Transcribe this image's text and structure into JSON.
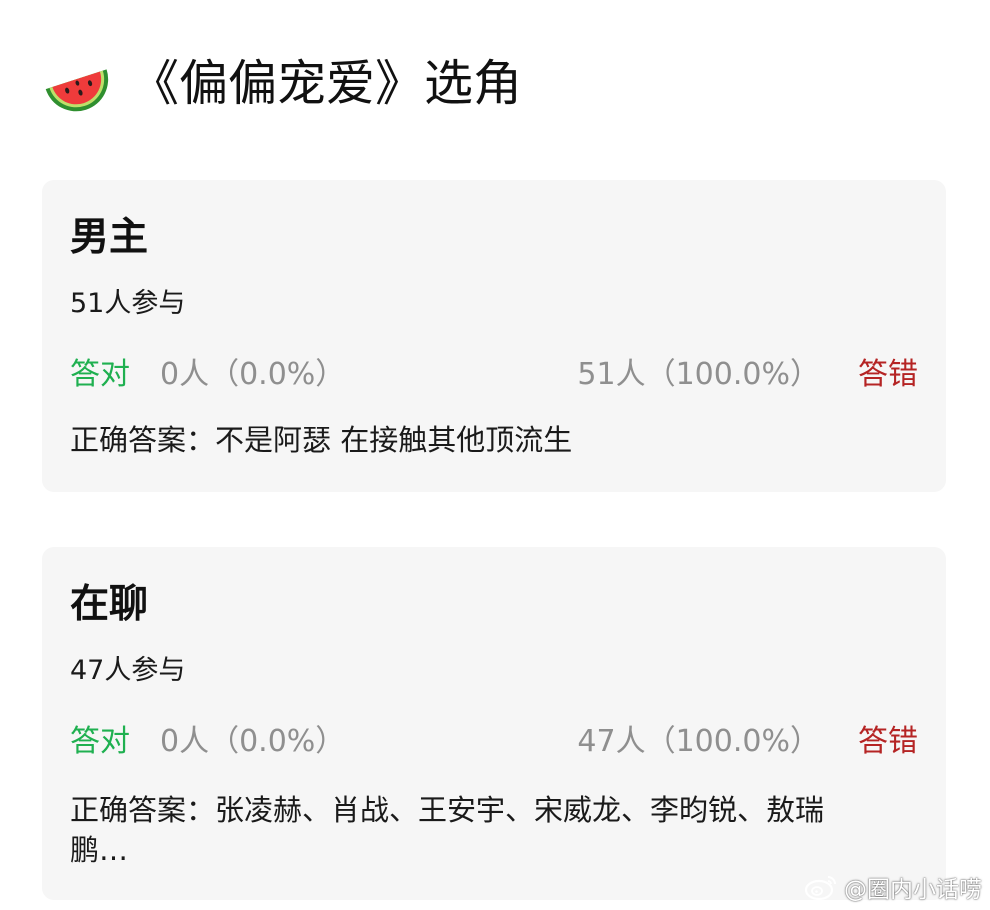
{
  "header": {
    "icon": "watermelon-icon",
    "title": "《偏偏宠爱》选角"
  },
  "cards": [
    {
      "title": "男主",
      "participants": "51人参与",
      "correct_label": "答对",
      "correct_stat": "0人（0.0%）",
      "wrong_stat": "51人（100.0%）",
      "wrong_label": "答错",
      "answer": "正确答案：不是阿瑟 在接触其他顶流生"
    },
    {
      "title": "在聊",
      "participants": "47人参与",
      "correct_label": "答对",
      "correct_stat": "0人（0.0%）",
      "wrong_stat": "47人（100.0%）",
      "wrong_label": "答错",
      "answer": "正确答案：张凌赫、肖战、王安宇、宋威龙、李昀锐、敖瑞鹏…"
    }
  ],
  "watermark": {
    "icon": "weibo-icon",
    "text": "@圈内小话唠"
  },
  "colors": {
    "correct": "#1fb050",
    "wrong": "#b52424",
    "stat_gray": "#8f8f8f",
    "card_bg": "#f6f6f6"
  }
}
